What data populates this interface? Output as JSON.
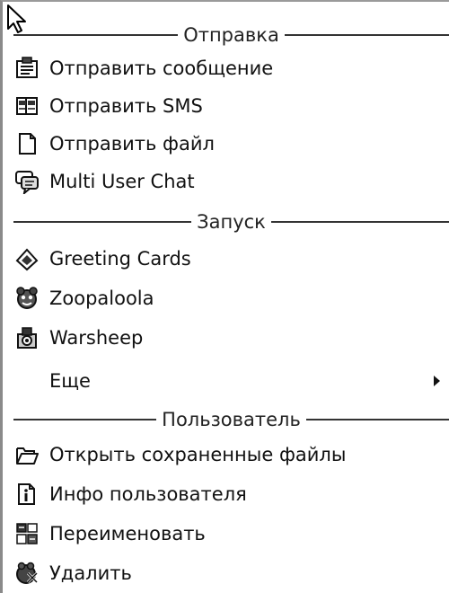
{
  "sections": {
    "send": "Отправка",
    "launch": "Запуск",
    "user": "Пользователь"
  },
  "items": {
    "send_message": "Отправить сообщение",
    "send_sms": "Отправить SMS",
    "send_file": "Отправить файл",
    "multi_user_chat": "Multi User Chat",
    "greeting_cards": "Greeting Cards",
    "zoopaloola": "Zoopaloola",
    "warsheep": "Warsheep",
    "more": "Еще",
    "open_saved_files": "Открыть сохраненные файлы",
    "user_info": "Инфо пользователя",
    "rename": "Переименовать",
    "delete": "Удалить"
  },
  "icons": {
    "send_message": "message-icon",
    "send_sms": "sms-icon",
    "send_file": "file-icon",
    "multi_user_chat": "chat-icon",
    "greeting_cards": "greeting-cards-icon",
    "zoopaloola": "zoopaloola-icon",
    "warsheep": "warsheep-icon",
    "more": "submenu-arrow-icon",
    "open_saved_files": "folder-open-icon",
    "user_info": "info-icon",
    "rename": "rename-icon",
    "delete": "delete-icon"
  }
}
